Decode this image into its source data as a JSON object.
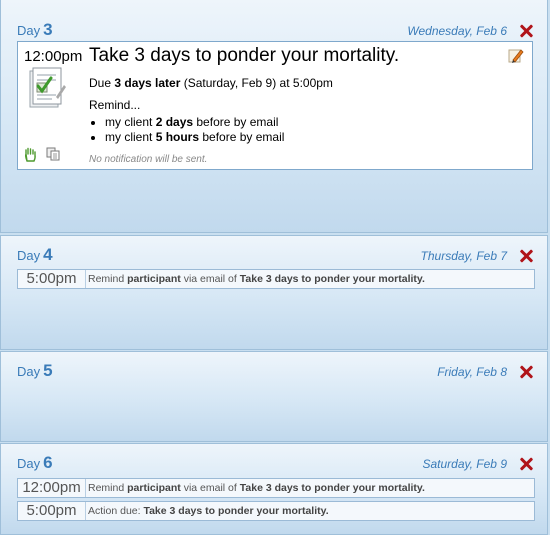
{
  "days": [
    {
      "word": "Day",
      "number": "3",
      "date": "Wednesday, Feb 6",
      "task": {
        "time": "12:00pm",
        "title": "Take 3 days to ponder your mortality.",
        "due_prefix": "Due ",
        "due_bold": "3 days later",
        "due_suffix": " (Saturday, Feb 9) at 5:00pm",
        "remind_head": "Remind...",
        "reminders": [
          {
            "prefix": "my client ",
            "bold": "2 days",
            "suffix": " before by email"
          },
          {
            "prefix": "my client ",
            "bold": "5 hours",
            "suffix": " before by email"
          }
        ],
        "notification": "No notification will be sent."
      }
    },
    {
      "word": "Day",
      "number": "4",
      "date": "Thursday, Feb 7",
      "items": [
        {
          "time": "5:00pm",
          "pre": "Remind ",
          "bold1": "participant",
          "mid": " via email of ",
          "bold2": "Take 3 days to ponder your mortality."
        }
      ]
    },
    {
      "word": "Day",
      "number": "5",
      "date": "Friday, Feb 8"
    },
    {
      "word": "Day",
      "number": "6",
      "date": "Saturday, Feb 9",
      "items": [
        {
          "time": "12:00pm",
          "pre": "Remind ",
          "bold1": "participant",
          "mid": " via email of ",
          "bold2": "Take 3 days to ponder your mortality."
        },
        {
          "time": "5:00pm",
          "pre": "Action due: ",
          "bold1": "Take 3 days to ponder your mortality."
        }
      ]
    }
  ],
  "icons": {
    "delete": "delete-x-icon",
    "edit": "pencil-icon",
    "task": "checklist-document-icon",
    "grab": "hand-icon",
    "copy": "copy-icon"
  },
  "colors": {
    "accent": "#3a7bb8",
    "delete": "#b0141a"
  }
}
